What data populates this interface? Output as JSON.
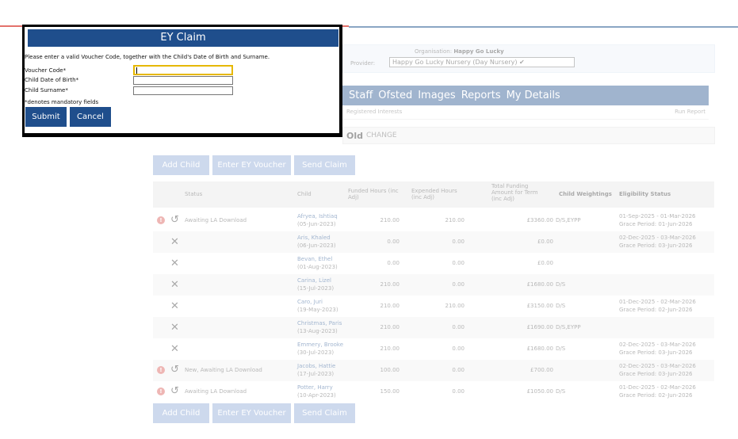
{
  "modal": {
    "title": "EY Claim",
    "instructions": "Please enter a valid Voucher Code, together with the Child's Date of Birth and Surname.",
    "voucher_label": "Voucher Code*",
    "voucher_value": "",
    "dob_label": "Child Date of Birth*",
    "dob_value": "",
    "surname_label": "Child Surname*",
    "surname_value": "",
    "mandatory_note": "*denotes mandatory fields",
    "submit_label": "Submit",
    "cancel_label": "Cancel"
  },
  "org": {
    "organisation_label": "Organisation:",
    "organisation_value": "Happy Go Lucky",
    "provider_label": "Provider:",
    "provider_value": "Happy Go Lucky Nursery (Day Nursery)",
    "provider_chevron": "✔"
  },
  "nav": {
    "items": [
      "Staff",
      "Ofsted",
      "Images",
      "Reports",
      "My Details"
    ],
    "sub_left": "Registered Interests",
    "sub_right": "Run Report"
  },
  "child_banner": {
    "text": "Old",
    "change": "CHANGE"
  },
  "actions": {
    "add_child": "Add Child",
    "enter_voucher": "Enter EY Voucher",
    "send_claim": "Send Claim"
  },
  "table": {
    "headers": {
      "status": "Status",
      "child": "Child",
      "funded_hours": "Funded Hours (inc Adj)",
      "expended_hours": "Expended Hours (inc Adj)",
      "total_funding": "Total Funding Amount for Term (inc Adj)",
      "weightings": "Child Weightings",
      "eligibility": "Eligibility Status"
    },
    "rows": [
      {
        "alert": true,
        "undo": true,
        "remove": false,
        "status": "Awaiting LA Download",
        "name": "Afryea, Ishtiaq",
        "dob": "(05-Jun-2023)",
        "funded": "210.00",
        "expended": "210.00",
        "total": "£3360.00",
        "weightings": "D/S,EYPP",
        "elig1": "01-Sep-2025 - 01-Mar-2026",
        "elig2": "Grace Period: 01-Jun-2026"
      },
      {
        "alert": false,
        "undo": false,
        "remove": true,
        "status": "",
        "name": "Aris, Khaled",
        "dob": "(06-Jun-2023)",
        "funded": "0.00",
        "expended": "0.00",
        "total": "£0.00",
        "weightings": "",
        "elig1": "02-Dec-2025 - 03-Mar-2026",
        "elig2": "Grace Period: 03-Jun-2026"
      },
      {
        "alert": false,
        "undo": false,
        "remove": true,
        "status": "",
        "name": "Bevan, Ethel",
        "dob": "(01-Aug-2023)",
        "funded": "0.00",
        "expended": "0.00",
        "total": "£0.00",
        "weightings": "",
        "elig1": "",
        "elig2": ""
      },
      {
        "alert": false,
        "undo": false,
        "remove": true,
        "status": "",
        "name": "Carina, Lizel",
        "dob": "(15-Jul-2023)",
        "funded": "210.00",
        "expended": "0.00",
        "total": "£1680.00",
        "weightings": "D/S",
        "elig1": "",
        "elig2": ""
      },
      {
        "alert": false,
        "undo": false,
        "remove": true,
        "status": "",
        "name": "Caro, Juri",
        "dob": "(19-May-2023)",
        "funded": "210.00",
        "expended": "210.00",
        "total": "£3150.00",
        "weightings": "D/S",
        "elig1": "01-Dec-2025 - 02-Mar-2026",
        "elig2": "Grace Period: 02-Jun-2026"
      },
      {
        "alert": false,
        "undo": false,
        "remove": true,
        "status": "",
        "name": "Christmas, Paris",
        "dob": "(13-Aug-2023)",
        "funded": "210.00",
        "expended": "0.00",
        "total": "£1690.00",
        "weightings": "D/S,EYPP",
        "elig1": "",
        "elig2": ""
      },
      {
        "alert": false,
        "undo": false,
        "remove": true,
        "status": "",
        "name": "Emmery, Brooke",
        "dob": "(30-Jul-2023)",
        "funded": "210.00",
        "expended": "0.00",
        "total": "£1680.00",
        "weightings": "D/S",
        "elig1": "02-Dec-2025 - 03-Mar-2026",
        "elig2": "Grace Period: 03-Jun-2026"
      },
      {
        "alert": true,
        "undo": true,
        "remove": false,
        "status": "New, Awaiting LA Download",
        "name": "Jacobs, Hattie",
        "dob": "(17-Jul-2023)",
        "funded": "100.00",
        "expended": "0.00",
        "total": "£700.00",
        "weightings": "",
        "elig1": "02-Dec-2025 - 03-Mar-2026",
        "elig2": "Grace Period: 03-Jun-2026"
      },
      {
        "alert": true,
        "undo": true,
        "remove": false,
        "status": "Awaiting LA Download",
        "name": "Potter, Harry",
        "dob": "(10-Apr-2023)",
        "funded": "150.00",
        "expended": "0.00",
        "total": "£1050.00",
        "weightings": "D/S",
        "elig1": "01-Dec-2025 - 02-Mar-2026",
        "elig2": "Grace Period: 02-Jun-2026"
      }
    ]
  },
  "icons": {
    "alert": "!",
    "undo": "↺",
    "remove": "✕"
  }
}
